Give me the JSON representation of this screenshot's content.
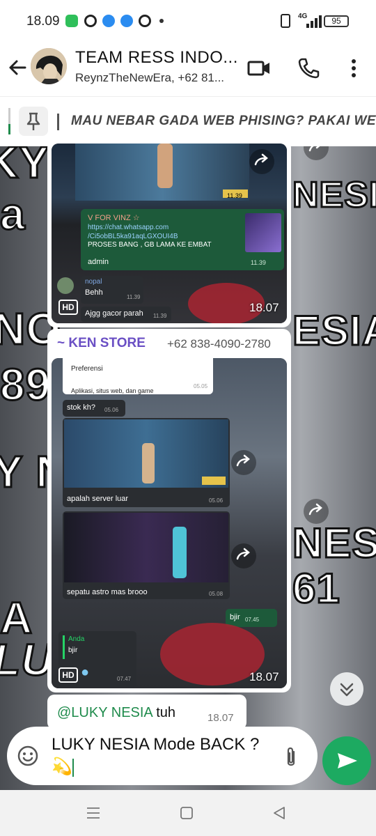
{
  "status_bar": {
    "time": "18.09",
    "network": "4G",
    "battery": "95",
    "notification_icons": [
      "whatsapp-business-icon",
      "app-icon",
      "app-icon",
      "app-icon",
      "app-icon"
    ]
  },
  "header": {
    "title": "TEAM RESS INDO...",
    "subtitle": "ReynzTheNewEra, +62 81..."
  },
  "pinned": {
    "text": "MAU NEBAR GADA WEB PHISING? PAKAI WE"
  },
  "background_text": [
    "KY",
    "a",
    "NESIA",
    "NO",
    "ESIA",
    "89",
    "Y N",
    "NES",
    "A",
    "61",
    "LU"
  ],
  "messages": {
    "first_album": {
      "card_title": "V FOR VINZ ☆",
      "card_link": "https://chat.whatsapp.com\n/Ci5obBL5ka91aqLGXOUI4B",
      "card_caption": "PROSES BANG , GB LAMA KE EMBAT",
      "card_sender": "admin",
      "card_time": "11.39",
      "shot_time": "11.39",
      "nopal_name": "nopal",
      "nopal_msg": "Behh",
      "nopal_time": "11.39",
      "gacor_msg": "Ajgg gacor parah",
      "gacor_time": "11.39",
      "hd": "HD",
      "time": "18.07"
    },
    "ken_store": {
      "sender": "~ KEN STORE",
      "phone": "+62 838-4090-2780",
      "pref_title": "Preferensi",
      "pref_sub": "Aplikasi, situs web, dan game",
      "pref_time": "05.05",
      "stok_msg": "stok kh?",
      "stok_time": "05.06",
      "server_msg": "apalah server luar",
      "server_time": "05.06",
      "sepatu_msg": "sepatu astro mas brooo",
      "sepatu_time": "05.08",
      "bjir_msg": "bjir",
      "bjir_time": "07.45",
      "anda_name": "Anda",
      "anda_msg": "bjir",
      "anda_time": "07.47",
      "hd": "HD",
      "time": "18.07"
    },
    "reply": {
      "mention": "@LUKY NESIA",
      "rest": " tuh",
      "time": "18.07"
    }
  },
  "input": {
    "text": "LUKY NESIA Mode BACK ? 💫"
  },
  "colors": {
    "accent_green": "#1daa61",
    "header_bg": "#ffffff",
    "ken_purple": "#6a4fc4"
  }
}
